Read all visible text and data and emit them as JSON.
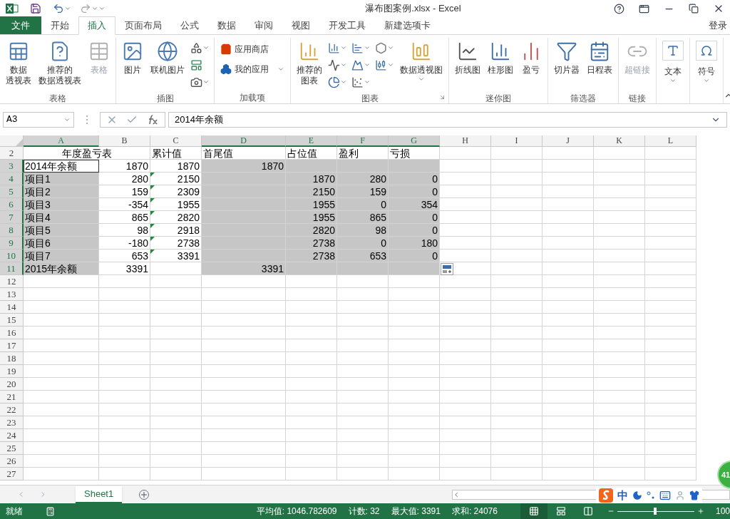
{
  "window": {
    "title": "瀑布图案例.xlsx - Excel",
    "login": "登录"
  },
  "file_tab": "文件",
  "tabs": [
    {
      "label": "开始",
      "selected": false
    },
    {
      "label": "插入",
      "selected": true
    },
    {
      "label": "页面布局",
      "selected": false
    },
    {
      "label": "公式",
      "selected": false
    },
    {
      "label": "数据",
      "selected": false
    },
    {
      "label": "审阅",
      "selected": false
    },
    {
      "label": "视图",
      "selected": false
    },
    {
      "label": "开发工具",
      "selected": false
    },
    {
      "label": "新建选项卡",
      "selected": false
    }
  ],
  "ribbon": [
    {
      "label": "表格",
      "items": [
        {
          "kind": "large",
          "lines": [
            "数据",
            "透视表"
          ],
          "disabled": false,
          "dropdown": false
        },
        {
          "kind": "large",
          "lines": [
            "推荐的",
            "数据透视表"
          ],
          "disabled": false,
          "dropdown": false
        },
        {
          "kind": "large",
          "label": "表格",
          "disabled": true,
          "dropdown": false
        }
      ]
    },
    {
      "label": "插图",
      "items": [
        {
          "kind": "large",
          "label": "图片",
          "disabled": false,
          "dropdown": false
        },
        {
          "kind": "large",
          "label": "联机图片",
          "disabled": false,
          "dropdown": false
        },
        {
          "kind": "stack",
          "items": [
            {
              "kind": "icon",
              "disabled": false,
              "dropdown": true
            },
            {
              "kind": "icon",
              "disabled": false,
              "dropdown": false
            },
            {
              "kind": "icon",
              "disabled": false,
              "dropdown": true
            }
          ]
        }
      ]
    },
    {
      "label": "加载项",
      "items": [
        {
          "kind": "stack",
          "items": [
            {
              "kind": "small",
              "label": "应用商店",
              "disabled": false,
              "dropdown": false
            },
            {
              "kind": "small",
              "label": "我的应用",
              "disabled": false,
              "dropdown": true
            }
          ]
        }
      ]
    },
    {
      "label": "图表",
      "launcher": true,
      "items": [
        {
          "kind": "large",
          "lines": [
            "推荐的",
            "图表"
          ],
          "disabled": false,
          "dropdown": false
        },
        {
          "kind": "stack",
          "items": [
            {
              "kind": "icon",
              "disabled": false,
              "dropdown": true
            },
            {
              "kind": "icon",
              "disabled": false,
              "dropdown": true
            },
            {
              "kind": "icon",
              "disabled": false,
              "dropdown": true
            }
          ]
        },
        {
          "kind": "stack",
          "items": [
            {
              "kind": "icon",
              "disabled": false,
              "dropdown": true
            },
            {
              "kind": "icon",
              "disabled": false,
              "dropdown": true
            },
            {
              "kind": "icon",
              "disabled": false,
              "dropdown": true
            }
          ]
        },
        {
          "kind": "stack",
          "items": [
            {
              "kind": "icon",
              "disabled": false,
              "dropdown": true
            },
            {
              "kind": "icon",
              "disabled": false,
              "dropdown": true
            }
          ]
        },
        {
          "kind": "large",
          "label": "数据透视图",
          "disabled": false,
          "dropdown": true
        }
      ]
    },
    {
      "label": "迷你图",
      "items": [
        {
          "kind": "large",
          "label": "折线图",
          "disabled": false,
          "dropdown": false
        },
        {
          "kind": "large",
          "label": "柱形图",
          "disabled": false,
          "dropdown": false
        },
        {
          "kind": "large",
          "label": "盈亏",
          "disabled": false,
          "dropdown": false
        }
      ]
    },
    {
      "label": "筛选器",
      "items": [
        {
          "kind": "large",
          "label": "切片器",
          "disabled": false,
          "dropdown": false
        },
        {
          "kind": "large",
          "label": "日程表",
          "disabled": false,
          "dropdown": false
        }
      ]
    },
    {
      "label": "链接",
      "items": [
        {
          "kind": "large",
          "label": "超链接",
          "disabled": true,
          "dropdown": false
        }
      ]
    },
    {
      "items": [
        {
          "kind": "boxed",
          "label": "文本",
          "disabled": false,
          "dropdown": true
        }
      ]
    },
    {
      "items": [
        {
          "kind": "boxed",
          "label": "符号",
          "disabled": false,
          "dropdown": true
        }
      ]
    }
  ],
  "formula_bar": {
    "name_box": "A3",
    "value": "2014年余额"
  },
  "columns": [
    {
      "label": "A",
      "selected": true
    },
    {
      "label": "B",
      "selected": false
    },
    {
      "label": "C",
      "selected": false
    },
    {
      "label": "D",
      "selected": true
    },
    {
      "label": "E",
      "selected": true
    },
    {
      "label": "F",
      "selected": true
    },
    {
      "label": "G",
      "selected": true
    },
    {
      "label": "H",
      "selected": false
    },
    {
      "label": "I",
      "selected": false
    },
    {
      "label": "J",
      "selected": false
    },
    {
      "label": "K",
      "selected": false
    },
    {
      "label": "L",
      "selected": false
    }
  ],
  "rows": [
    {
      "number": "2",
      "selected": false,
      "cells": [
        {
          "text": "年度盈亏表",
          "kind": "heading",
          "selected": false,
          "active": false,
          "flagged": false
        },
        {
          "text": "累计值",
          "kind": "text",
          "selected": false,
          "active": false,
          "flagged": false
        },
        {
          "text": "首尾值",
          "kind": "text",
          "selected": false,
          "active": false,
          "flagged": false
        },
        {
          "text": "占位值",
          "kind": "text",
          "selected": false,
          "active": false,
          "flagged": false
        },
        {
          "text": "盈利",
          "kind": "text",
          "selected": false,
          "active": false,
          "flagged": false
        },
        {
          "text": "亏损",
          "kind": "text",
          "selected": false,
          "active": false,
          "flagged": false
        }
      ]
    },
    {
      "number": "3",
      "selected": true,
      "cells": [
        {
          "text": "2014年余额",
          "kind": "text",
          "selected": true,
          "active": true,
          "flagged": false
        },
        {
          "text": "1870",
          "kind": "number",
          "selected": false,
          "active": false,
          "flagged": false
        },
        {
          "text": "1870",
          "kind": "number",
          "selected": false,
          "active": false,
          "flagged": false
        },
        {
          "text": "1870",
          "kind": "number",
          "selected": true,
          "active": false,
          "flagged": false
        },
        {
          "selected": true,
          "active": false,
          "flagged": false
        },
        {
          "selected": true,
          "active": false,
          "flagged": false
        },
        {
          "selected": true,
          "active": false,
          "flagged": false
        }
      ]
    },
    {
      "number": "4",
      "selected": true,
      "cells": [
        {
          "text": "项目1",
          "kind": "text",
          "selected": true,
          "active": false,
          "flagged": false
        },
        {
          "text": "280",
          "kind": "number",
          "selected": false,
          "active": false,
          "flagged": false
        },
        {
          "text": "2150",
          "kind": "number",
          "selected": false,
          "active": false,
          "flagged": true
        },
        {
          "selected": true,
          "active": false,
          "flagged": false
        },
        {
          "text": "1870",
          "kind": "number",
          "selected": true,
          "active": false,
          "flagged": false
        },
        {
          "text": "280",
          "kind": "number",
          "selected": true,
          "active": false,
          "flagged": false
        },
        {
          "text": "0",
          "kind": "number",
          "selected": true,
          "active": false,
          "flagged": false
        }
      ]
    },
    {
      "number": "5",
      "selected": true,
      "cells": [
        {
          "text": "项目2",
          "kind": "text",
          "selected": true,
          "active": false,
          "flagged": false
        },
        {
          "text": "159",
          "kind": "number",
          "selected": false,
          "active": false,
          "flagged": false
        },
        {
          "text": "2309",
          "kind": "number",
          "selected": false,
          "active": false,
          "flagged": true
        },
        {
          "selected": true,
          "active": false,
          "flagged": false
        },
        {
          "text": "2150",
          "kind": "number",
          "selected": true,
          "active": false,
          "flagged": false
        },
        {
          "text": "159",
          "kind": "number",
          "selected": true,
          "active": false,
          "flagged": false
        },
        {
          "text": "0",
          "kind": "number",
          "selected": true,
          "active": false,
          "flagged": false
        }
      ]
    },
    {
      "number": "6",
      "selected": true,
      "cells": [
        {
          "text": "项目3",
          "kind": "text",
          "selected": true,
          "active": false,
          "flagged": false
        },
        {
          "text": "-354",
          "kind": "number",
          "selected": false,
          "active": false,
          "flagged": false
        },
        {
          "text": "1955",
          "kind": "number",
          "selected": false,
          "active": false,
          "flagged": true
        },
        {
          "selected": true,
          "active": false,
          "flagged": false
        },
        {
          "text": "1955",
          "kind": "number",
          "selected": true,
          "active": false,
          "flagged": false
        },
        {
          "text": "0",
          "kind": "number",
          "selected": true,
          "active": false,
          "flagged": false
        },
        {
          "text": "354",
          "kind": "number",
          "selected": true,
          "active": false,
          "flagged": false
        }
      ]
    },
    {
      "number": "7",
      "selected": true,
      "cells": [
        {
          "text": "项目4",
          "kind": "text",
          "selected": true,
          "active": false,
          "flagged": false
        },
        {
          "text": "865",
          "kind": "number",
          "selected": false,
          "active": false,
          "flagged": false
        },
        {
          "text": "2820",
          "kind": "number",
          "selected": false,
          "active": false,
          "flagged": true
        },
        {
          "selected": true,
          "active": false,
          "flagged": false
        },
        {
          "text": "1955",
          "kind": "number",
          "selected": true,
          "active": false,
          "flagged": false
        },
        {
          "text": "865",
          "kind": "number",
          "selected": true,
          "active": false,
          "flagged": false
        },
        {
          "text": "0",
          "kind": "number",
          "selected": true,
          "active": false,
          "flagged": false
        }
      ]
    },
    {
      "number": "8",
      "selected": true,
      "cells": [
        {
          "text": "项目5",
          "kind": "text",
          "selected": true,
          "active": false,
          "flagged": false
        },
        {
          "text": "98",
          "kind": "number",
          "selected": false,
          "active": false,
          "flagged": false
        },
        {
          "text": "2918",
          "kind": "number",
          "selected": false,
          "active": false,
          "flagged": true
        },
        {
          "selected": true,
          "active": false,
          "flagged": false
        },
        {
          "text": "2820",
          "kind": "number",
          "selected": true,
          "active": false,
          "flagged": false
        },
        {
          "text": "98",
          "kind": "number",
          "selected": true,
          "active": false,
          "flagged": false
        },
        {
          "text": "0",
          "kind": "number",
          "selected": true,
          "active": false,
          "flagged": false
        }
      ]
    },
    {
      "number": "9",
      "selected": true,
      "cells": [
        {
          "text": "项目6",
          "kind": "text",
          "selected": true,
          "active": false,
          "flagged": false
        },
        {
          "text": "-180",
          "kind": "number",
          "selected": false,
          "active": false,
          "flagged": false
        },
        {
          "text": "2738",
          "kind": "number",
          "selected": false,
          "active": false,
          "flagged": true
        },
        {
          "selected": true,
          "active": false,
          "flagged": false
        },
        {
          "text": "2738",
          "kind": "number",
          "selected": true,
          "active": false,
          "flagged": false
        },
        {
          "text": "0",
          "kind": "number",
          "selected": true,
          "active": false,
          "flagged": false
        },
        {
          "text": "180",
          "kind": "number",
          "selected": true,
          "active": false,
          "flagged": false
        }
      ]
    },
    {
      "number": "10",
      "selected": true,
      "cells": [
        {
          "text": "项目7",
          "kind": "text",
          "selected": true,
          "active": false,
          "flagged": false
        },
        {
          "text": "653",
          "kind": "number",
          "selected": false,
          "active": false,
          "flagged": false
        },
        {
          "text": "3391",
          "kind": "number",
          "selected": false,
          "active": false,
          "flagged": true
        },
        {
          "selected": true,
          "active": false,
          "flagged": false
        },
        {
          "text": "2738",
          "kind": "number",
          "selected": true,
          "active": false,
          "flagged": false
        },
        {
          "text": "653",
          "kind": "number",
          "selected": true,
          "active": false,
          "flagged": false
        },
        {
          "text": "0",
          "kind": "number",
          "selected": true,
          "active": false,
          "flagged": false
        }
      ]
    },
    {
      "number": "11",
      "selected": true,
      "cells": [
        {
          "text": "2015年余额",
          "kind": "text",
          "selected": true,
          "active": false,
          "flagged": false
        },
        {
          "text": "3391",
          "kind": "number",
          "selected": false,
          "active": false,
          "flagged": false
        },
        {
          "selected": false,
          "active": false,
          "flagged": false
        },
        {
          "text": "3391",
          "kind": "number",
          "selected": true,
          "active": false,
          "flagged": false
        },
        {
          "selected": true,
          "active": false,
          "flagged": false
        },
        {
          "selected": true,
          "active": false,
          "flagged": false
        },
        {
          "selected": true,
          "active": false,
          "flagged": false
        }
      ]
    },
    {
      "number": "12",
      "selected": false
    },
    {
      "number": "13",
      "selected": false
    },
    {
      "number": "14",
      "selected": false
    },
    {
      "number": "15",
      "selected": false
    },
    {
      "number": "16",
      "selected": false
    },
    {
      "number": "17",
      "selected": false
    },
    {
      "number": "18",
      "selected": false
    },
    {
      "number": "19",
      "selected": false
    },
    {
      "number": "20",
      "selected": false
    },
    {
      "number": "21",
      "selected": false
    },
    {
      "number": "22",
      "selected": false
    },
    {
      "number": "23",
      "selected": false
    },
    {
      "number": "24",
      "selected": false
    },
    {
      "number": "25",
      "selected": false
    },
    {
      "number": "26",
      "selected": false
    },
    {
      "number": "27",
      "selected": false
    }
  ],
  "sheet_tabs": [
    {
      "label": "Sheet1",
      "selected": true
    }
  ],
  "status_bar": {
    "ready": "就绪",
    "stats": [
      "平均值: 1046.782609",
      "计数: 32",
      "最大值: 3391",
      "求和: 24076"
    ],
    "views": [
      {
        "selected": true
      },
      {
        "selected": false
      },
      {
        "selected": false
      }
    ],
    "zoom": {
      "level": 0.47,
      "label": "100"
    }
  },
  "ime_toolbar": {
    "mode": "中"
  },
  "side_badge": "41"
}
